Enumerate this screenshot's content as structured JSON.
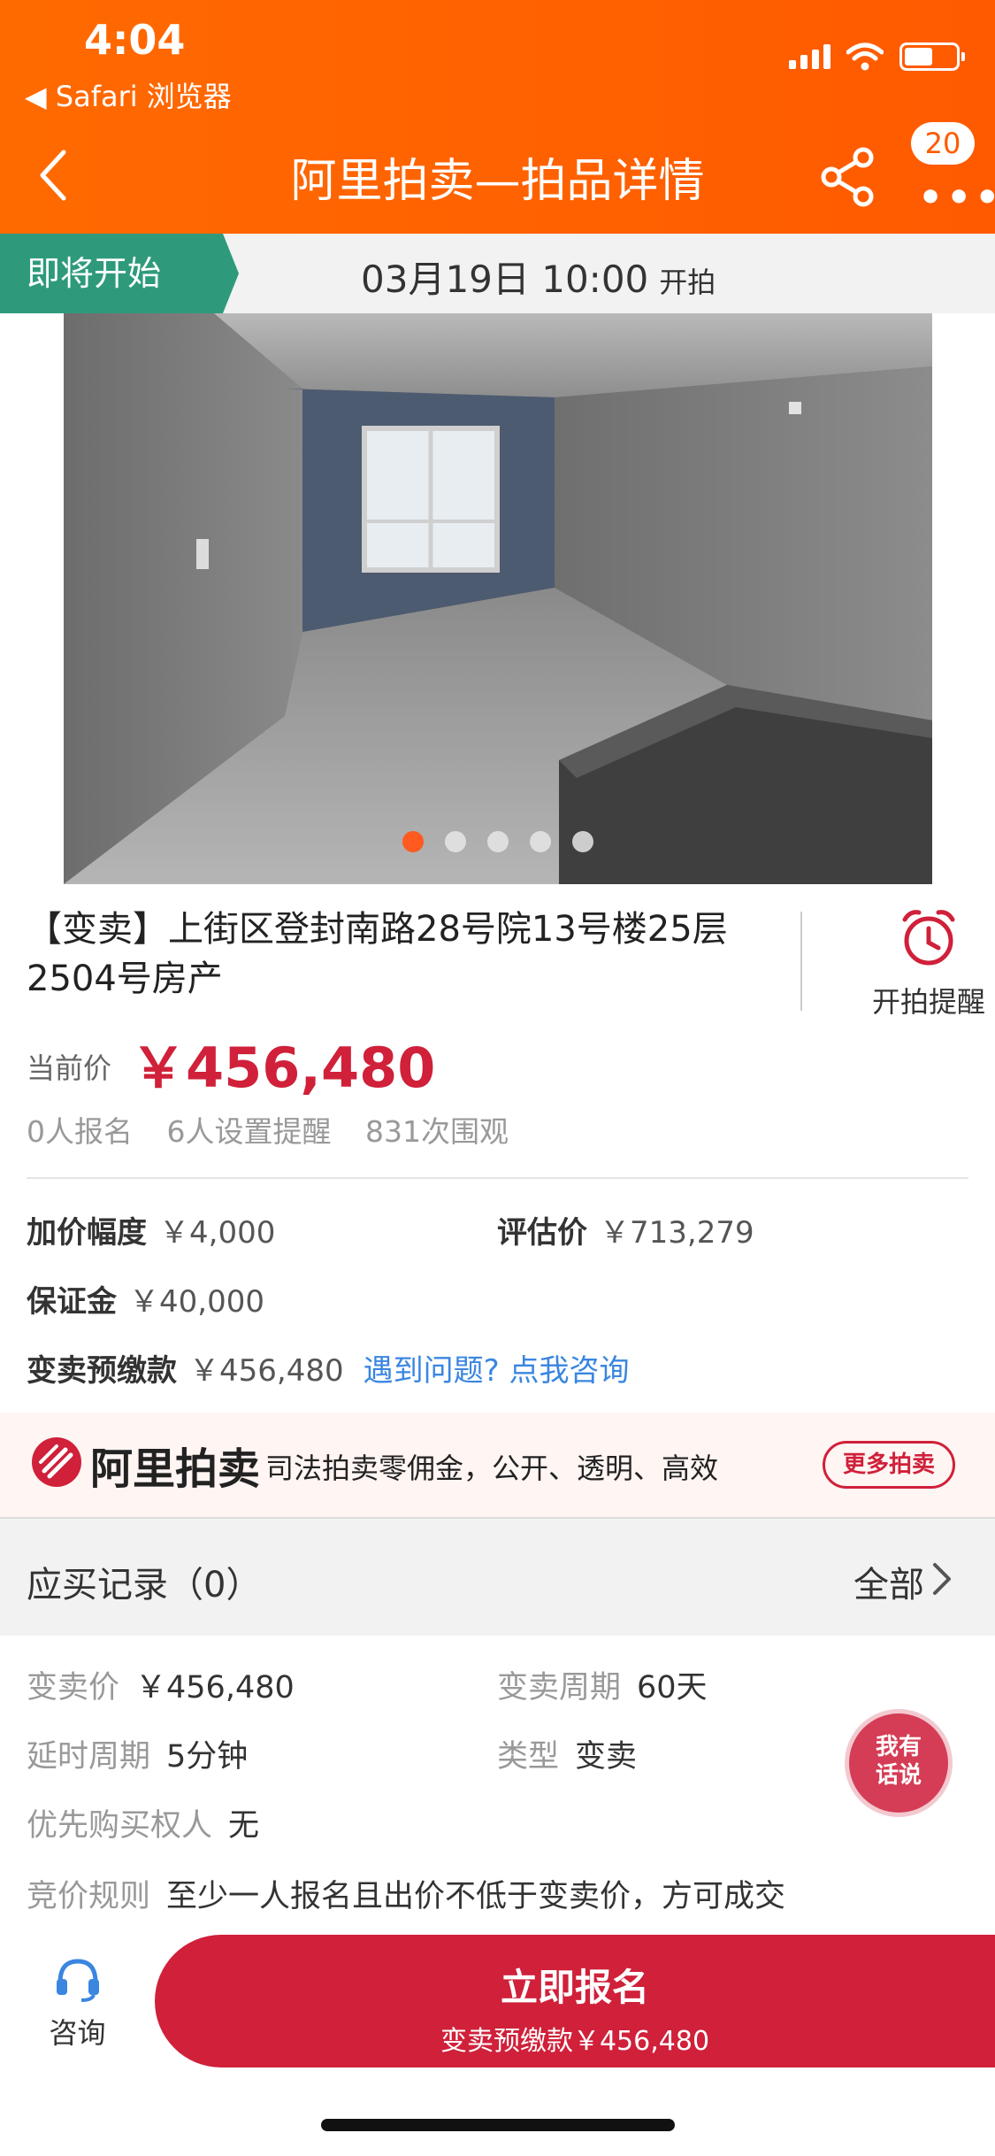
{
  "status_bar": {
    "time": "4:04",
    "back_app": "◀ Safari 浏览器"
  },
  "nav": {
    "title": "阿里拍卖—拍品详情",
    "badge": "20"
  },
  "auction_status": {
    "tag": "即将开始",
    "date_time": "03月19日 10:00",
    "suffix": "开拍"
  },
  "gallery": {
    "count": 5,
    "active_index": 0
  },
  "item": {
    "title": "【变卖】上街区登封南路28号院13号楼25层2504号房产",
    "reminder_label": "开拍提醒",
    "price_label": "当前价",
    "price_value": "￥456,480",
    "stats": {
      "signups": "0人报名",
      "reminders": "6人设置提醒",
      "views": "831次围观"
    }
  },
  "fees": {
    "increment_label": "加价幅度",
    "increment_value": "￥4,000",
    "appraisal_label": "评估价",
    "appraisal_value": "￥713,279",
    "deposit_label": "保证金",
    "deposit_value": "￥40,000",
    "prepay_label": "变卖预缴款",
    "prepay_value": "￥456,480",
    "help_link": "遇到问题?  点我咨询"
  },
  "promo": {
    "brand": "阿里拍卖",
    "slogan": "司法拍卖零佣金，公开、透明、高效",
    "button": "更多拍卖"
  },
  "records": {
    "title": "应买记录（0）",
    "all": "全部"
  },
  "details": {
    "sale_price_label": "变卖价",
    "sale_price_value": "￥456,480",
    "period_label": "变卖周期",
    "period_value": "60天",
    "delay_label": "延时周期",
    "delay_value": "5分钟",
    "type_label": "类型",
    "type_value": "变卖",
    "priority_label": "优先购买权人",
    "priority_value": "无",
    "rule_label": "竞价规则",
    "rule_value": "至少一人报名且出价不低于变卖价，方可成交"
  },
  "chat_bubble": {
    "line1": "我有",
    "line2": "话说"
  },
  "bottom": {
    "consult": "咨询",
    "signup_main": "立即报名",
    "signup_sub": "变卖预缴款￥456,480"
  },
  "colors": {
    "brand_orange": "#ff5a00",
    "price_red": "#d0203a",
    "status_green": "#2e9a7b",
    "link_blue": "#3a86e0"
  }
}
